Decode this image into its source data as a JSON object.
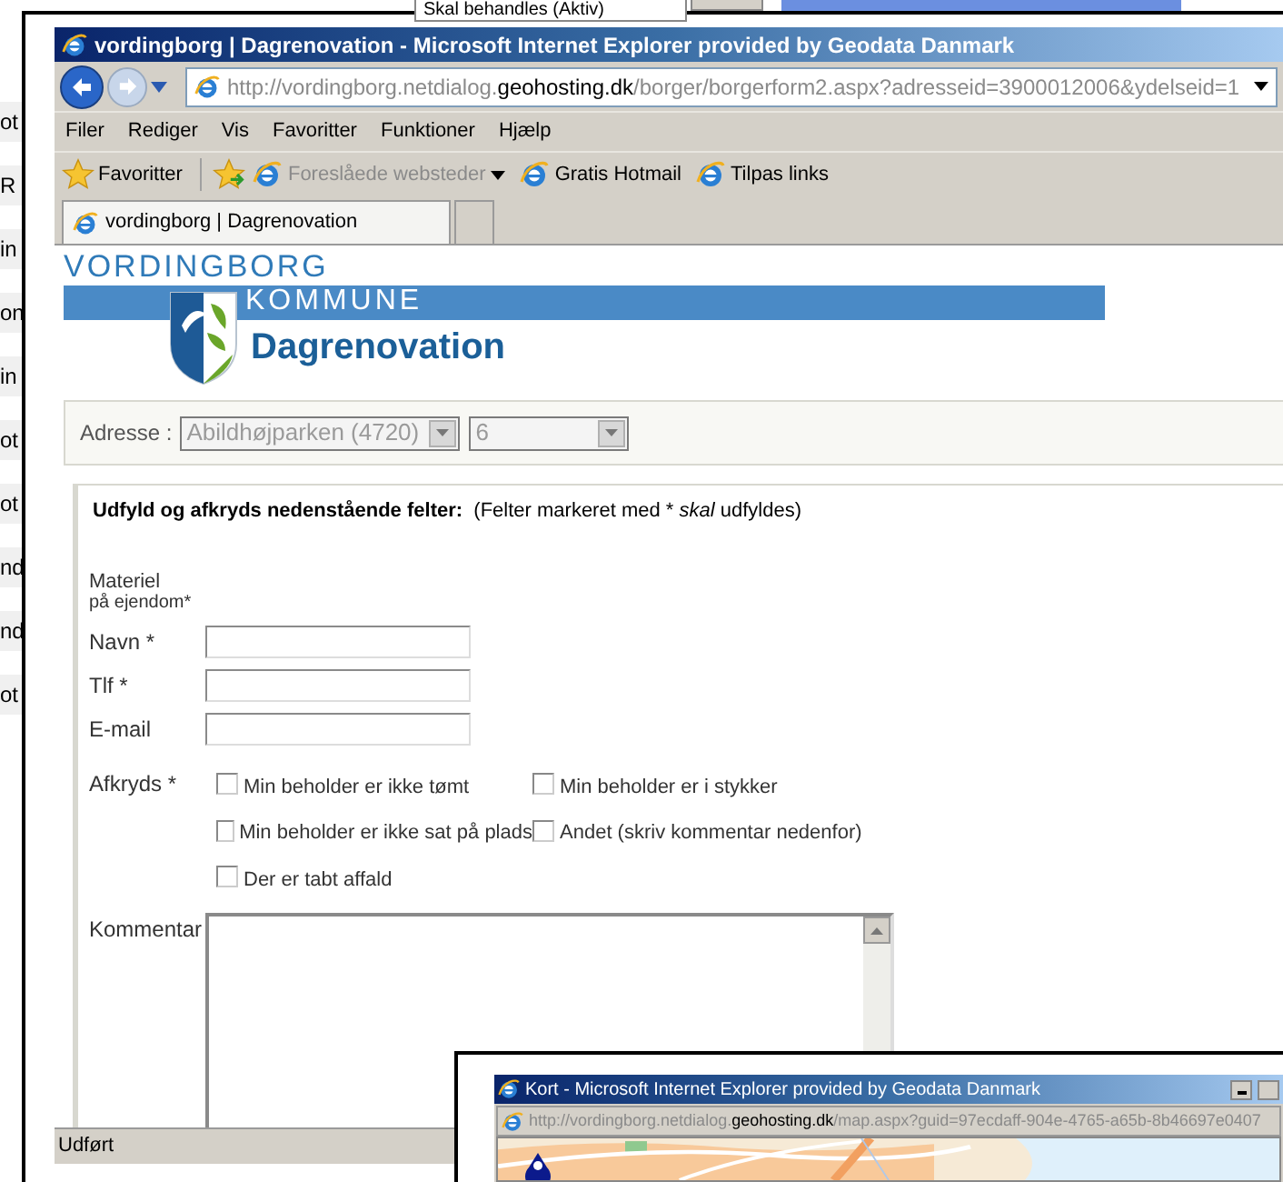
{
  "background_window": {
    "status_field": "Skal behandles (Aktiv)",
    "left_fragments": [
      "ot",
      "R",
      "in",
      "on",
      "in",
      "ot",
      "ot",
      "nd",
      "nd",
      "ot"
    ]
  },
  "main_window": {
    "title": "vordingborg | Dagrenovation - Microsoft Internet Explorer provided by Geodata Danmark",
    "address": {
      "before": "http://vordingborg.netdialog.",
      "domain": "geohosting.dk",
      "after": "/borger/borgerform2.aspx?adresseid=3900012006&ydelseid=1"
    },
    "menu": [
      "Filer",
      "Rediger",
      "Vis",
      "Favoritter",
      "Funktioner",
      "Hjælp"
    ],
    "favorites_bar": [
      {
        "kind": "favorites",
        "label": "Favoritter",
        "disabled": false
      },
      {
        "kind": "dropdown",
        "label": "Foreslåede websteder",
        "disabled": true
      },
      {
        "kind": "link",
        "label": "Gratis Hotmail",
        "disabled": false
      },
      {
        "kind": "link",
        "label": "Tilpas links",
        "disabled": false
      }
    ],
    "tabs": [
      {
        "label": "vordingborg | Dagrenovation",
        "selected": true
      }
    ],
    "page": {
      "logo": {
        "top": "VORDINGBORG",
        "band": "KOMMUNE"
      },
      "heading": "Dagrenovation",
      "address": {
        "label": "Adresse :",
        "street": {
          "value": "Abildhøjparken (4720)",
          "disabled": true
        },
        "number": {
          "value": "6",
          "disabled": true
        }
      },
      "form": {
        "instruction": "**Udfyld og afkryds nedenstående felter:**  (Felter markeret med * *skal* udfyldes)",
        "material_label": [
          "Materiel",
          "på ejendom*"
        ],
        "fields": [
          {
            "label": "Navn *"
          },
          {
            "label": "Tlf *"
          },
          {
            "label": "E-mail"
          }
        ],
        "checks_label": "Afkryds *",
        "checks": [
          {
            "label": "Min beholder er ikke tømt",
            "checked": false
          },
          {
            "label": "Min beholder er i stykker",
            "checked": false
          },
          {
            "label": "Min beholder er ikke sat på plads",
            "checked": false
          },
          {
            "label": "Andet (skriv kommentar nedenfor)",
            "checked": false
          },
          {
            "label": "Der er tabt affald",
            "checked": false
          }
        ],
        "comment_label": "Kommentar"
      }
    },
    "status_bar": "Udført"
  },
  "popup_window": {
    "title": "Kort - Microsoft Internet Explorer provided by Geodata Danmark",
    "address": {
      "before": "http://vordingborg.netdialog.",
      "domain": "geohosting.dk",
      "after": "/map.aspx?guid=97ecdaff-904e-4765-a65b-8b46697e0407"
    }
  }
}
